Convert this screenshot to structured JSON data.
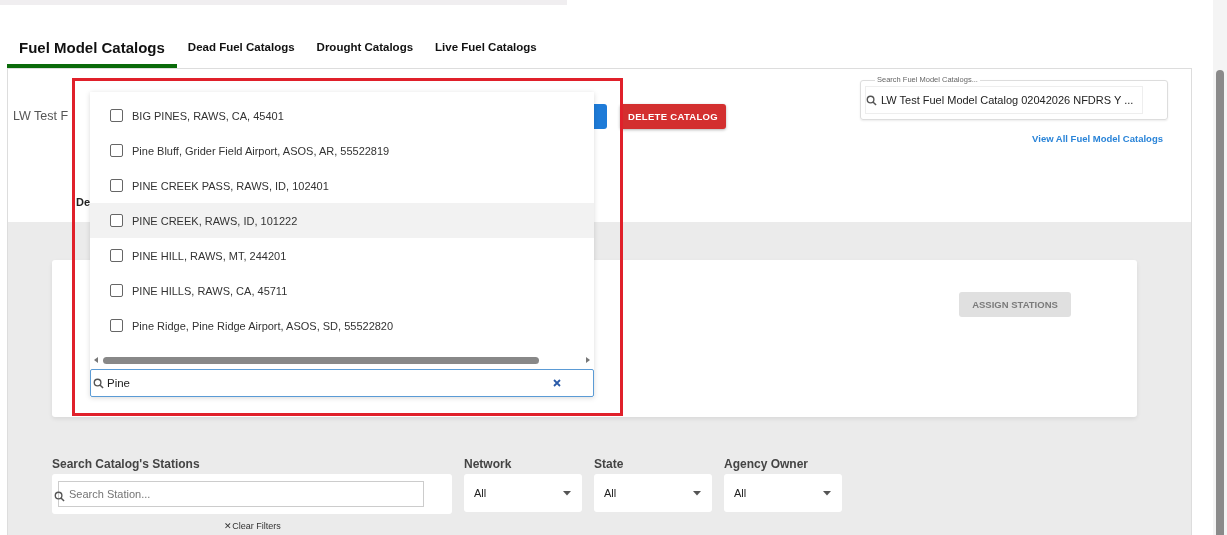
{
  "tabs": [
    {
      "label": "Fuel Model Catalogs",
      "selected": true
    },
    {
      "label": "Dead Fuel Catalogs",
      "selected": false
    },
    {
      "label": "Drought Catalogs",
      "selected": false
    },
    {
      "label": "Live Fuel Catalogs",
      "selected": false
    }
  ],
  "catalog": {
    "title": "LW Test F",
    "delete_button": "DELETE CATALOG",
    "section_label": "De"
  },
  "catalog_search": {
    "label": "Search Fuel Model Catalogs...",
    "value": "LW Test Fuel Model Catalog 02042026 NFDRS Y ...",
    "link": "View All Fuel Model Catalogs"
  },
  "assign_button": {
    "label": "ASSIGN STATIONS",
    "disabled": true
  },
  "filters": {
    "search": {
      "label": "Search Catalog's Stations",
      "placeholder": "Search Station..."
    },
    "selects": [
      {
        "label": "Network",
        "value": "All"
      },
      {
        "label": "State",
        "value": "All"
      },
      {
        "label": "Agency Owner",
        "value": "All"
      }
    ],
    "clear": {
      "icon": "✕",
      "label": "Clear Filters"
    }
  },
  "dropdown": {
    "options": [
      {
        "label": "BIG PINES, RAWS, CA, 45401",
        "checked": false,
        "highlighted": false
      },
      {
        "label": "Pine Bluff, Grider Field Airport, ASOS, AR, 55522819",
        "checked": false,
        "highlighted": false
      },
      {
        "label": "PINE CREEK PASS, RAWS, ID, 102401",
        "checked": false,
        "highlighted": false
      },
      {
        "label": "PINE CREEK, RAWS, ID, 101222",
        "checked": false,
        "highlighted": true
      },
      {
        "label": "PINE HILL, RAWS, MT, 244201",
        "checked": false,
        "highlighted": false
      },
      {
        "label": "PINE HILLS, RAWS, CA, 45711",
        "checked": false,
        "highlighted": false
      },
      {
        "label": "Pine Ridge, Pine Ridge Airport, ASOS, SD, 55522820",
        "checked": false,
        "highlighted": false
      }
    ],
    "search_value": "Pine"
  }
}
